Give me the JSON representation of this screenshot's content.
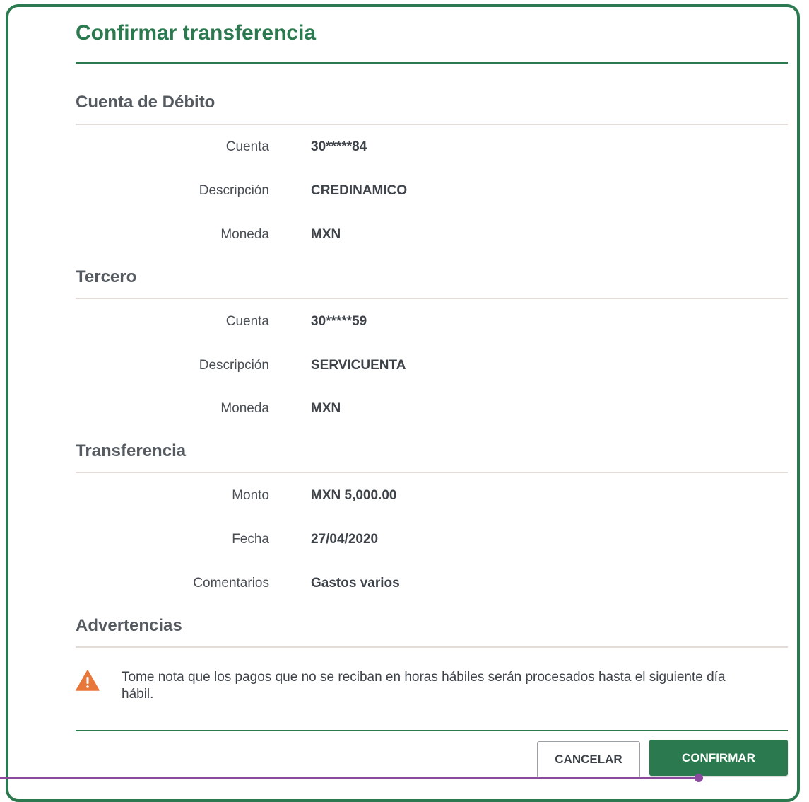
{
  "dialog": {
    "title": "Confirmar transferencia"
  },
  "sections": {
    "debit": {
      "title": "Cuenta de Débito",
      "rows": [
        {
          "label": "Cuenta",
          "value": "30*****84"
        },
        {
          "label": "Descripción",
          "value": "CREDINAMICO"
        },
        {
          "label": "Moneda",
          "value": "MXN"
        }
      ]
    },
    "third_party": {
      "title": "Tercero",
      "rows": [
        {
          "label": "Cuenta",
          "value": "30*****59"
        },
        {
          "label": "Descripción",
          "value": "SERVICUENTA"
        },
        {
          "label": "Moneda",
          "value": "MXN"
        }
      ]
    },
    "transfer": {
      "title": "Transferencia",
      "rows": [
        {
          "label": "Monto",
          "value": "MXN 5,000.00"
        },
        {
          "label": "Fecha",
          "value": "27/04/2020"
        },
        {
          "label": "Comentarios",
          "value": "Gastos varios"
        }
      ]
    },
    "warnings": {
      "title": "Advertencias",
      "icon": "warning-triangle-icon",
      "message": "Tome nota que los pagos que no se reciban en horas hábiles serán procesados hasta el siguiente día hábil."
    }
  },
  "actions": {
    "cancel_label": "CANCELAR",
    "confirm_label": "CONFIRMAR"
  },
  "colors": {
    "brand_green": "#2b7a4f",
    "warning_orange": "#e8773a",
    "divider": "#e3dcd8"
  }
}
